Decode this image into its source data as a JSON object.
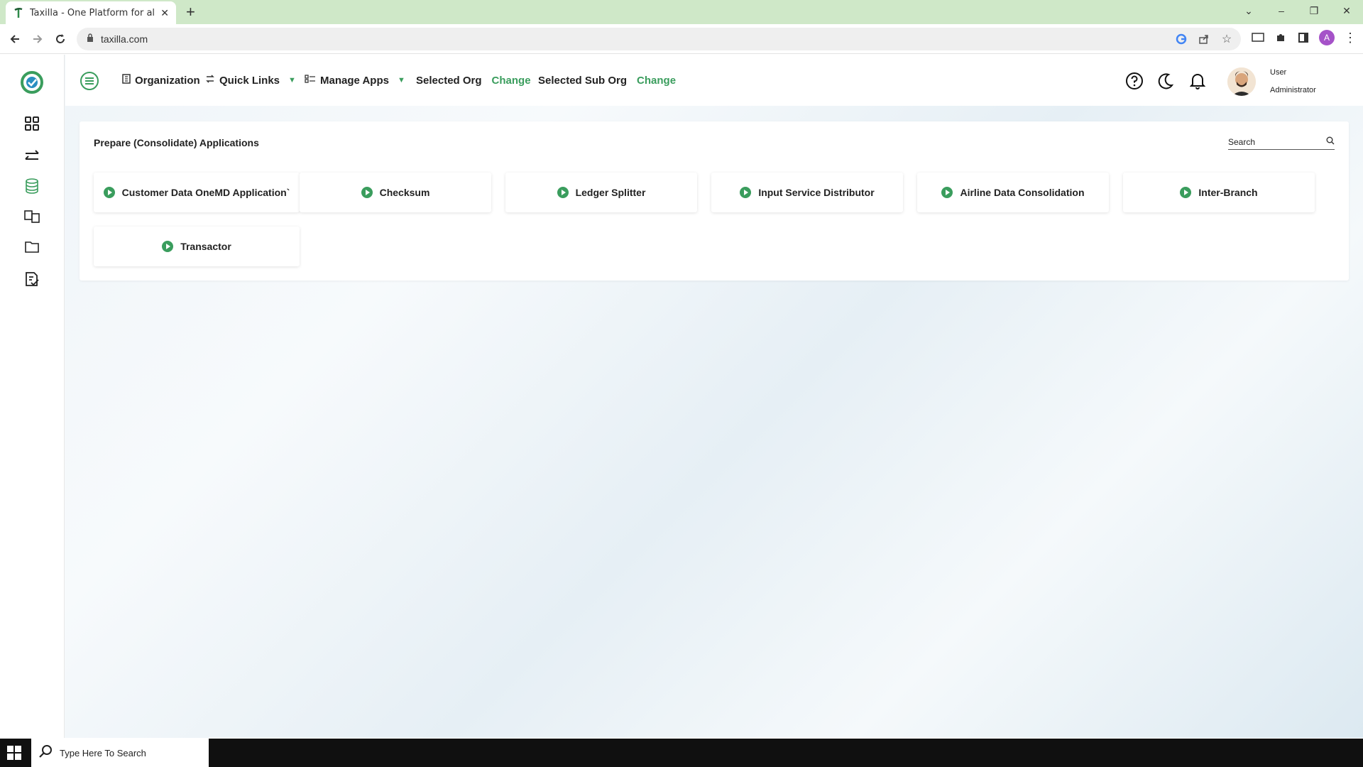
{
  "browser": {
    "tab_title": "Taxilla - One Platform for all Ent",
    "url": "taxilla.com",
    "profile_initial": "A"
  },
  "header": {
    "organization": "Organization",
    "quick_links": "Quick Links",
    "manage_apps": "Manage Apps",
    "selected_org": "Selected Org",
    "selected_org_change": "Change",
    "selected_sub_org": "Selected Sub Org",
    "selected_sub_org_change": "Change",
    "user_name": "User",
    "user_role": "Administrator"
  },
  "panel": {
    "title": "Prepare (Consolidate) Applications",
    "search_placeholder": "Search",
    "apps": [
      {
        "label": "Customer Data OneMD Application`"
      },
      {
        "label": "Checksum"
      },
      {
        "label": "Ledger Splitter"
      },
      {
        "label": "Input Service Distributor"
      },
      {
        "label": "Airline Data Consolidation"
      },
      {
        "label": "Inter-Branch"
      },
      {
        "label": "Transactor"
      }
    ]
  },
  "taskbar": {
    "search_placeholder": "Type Here To Search"
  },
  "colors": {
    "accent": "#3a9d5d",
    "tabbar": "#cfe8c8"
  },
  "icons": {
    "sidebar": [
      "dashboard-icon",
      "transfer-icon",
      "database-icon",
      "exchange-icon",
      "folder-icon",
      "report-check-icon"
    ],
    "header": [
      "help-icon",
      "moon-icon",
      "bell-icon"
    ]
  }
}
